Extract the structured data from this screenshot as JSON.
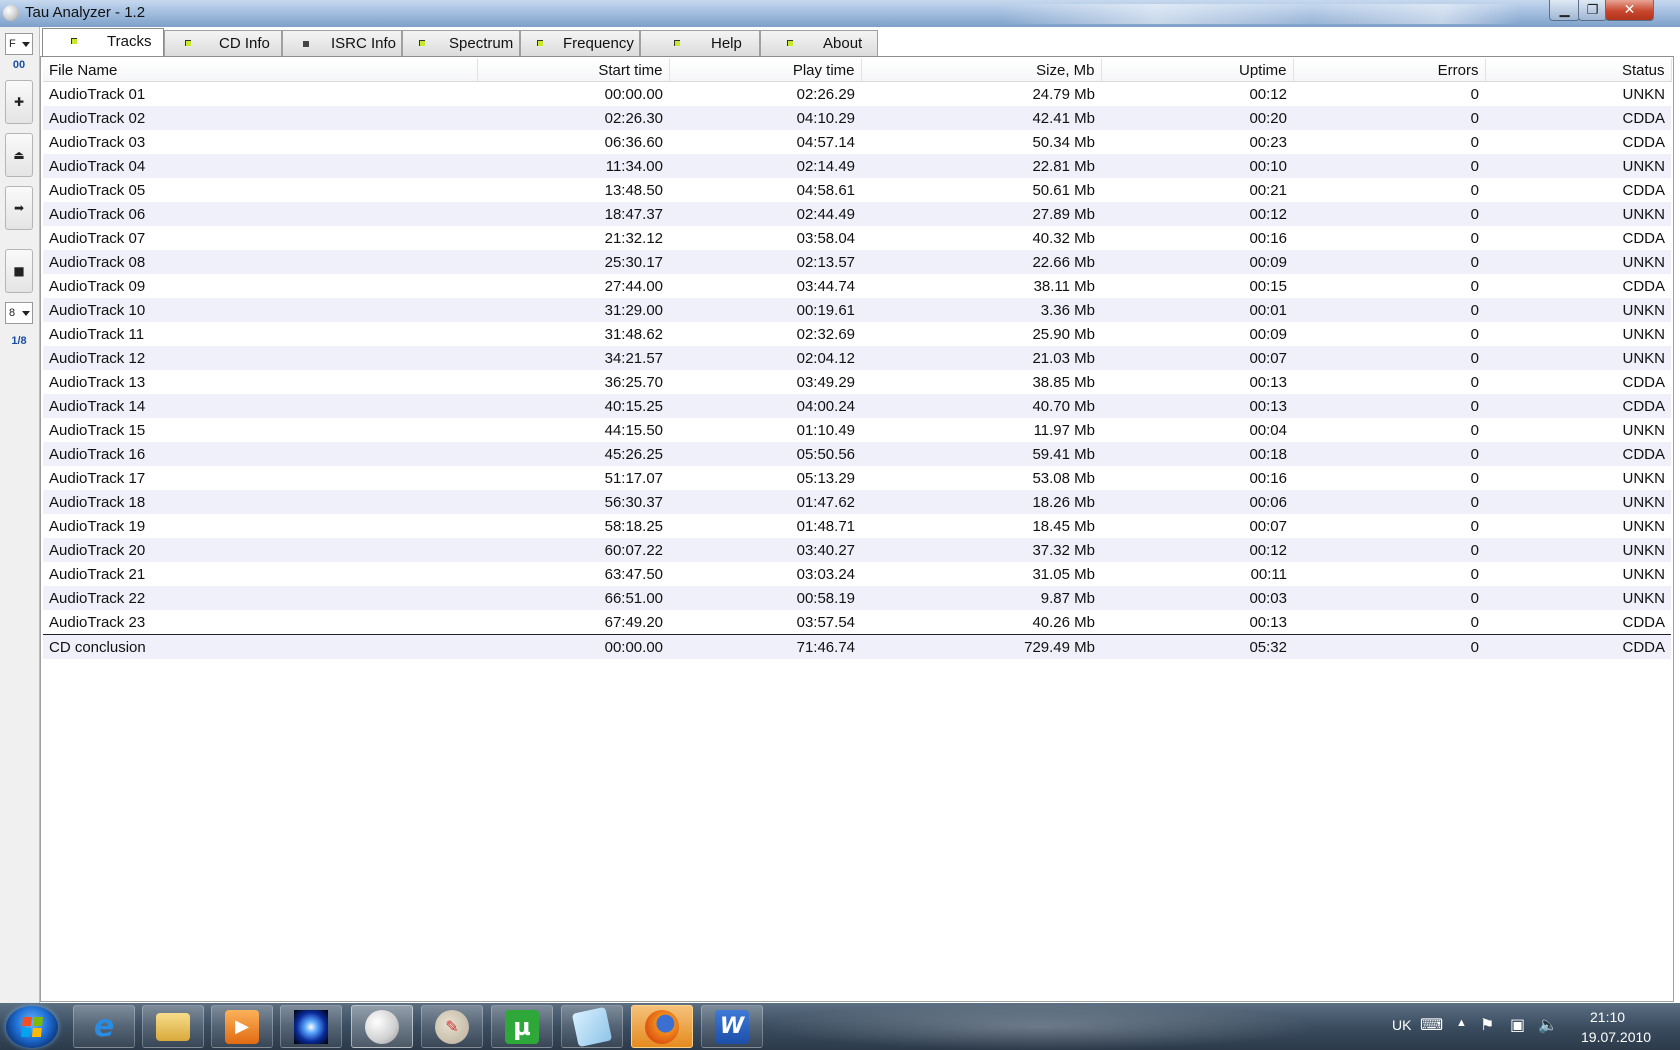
{
  "window": {
    "title": "Tau Analyzer - 1.2"
  },
  "left_toolbar": {
    "top_combo_value": "F",
    "top_label": "00",
    "bottom_combo_value": "8",
    "bottom_label": "1/8",
    "buttons": [
      "plus-icon",
      "eject-icon",
      "forward-icon",
      "stop-icon"
    ]
  },
  "tabs": [
    {
      "label": "Tracks",
      "active": true
    },
    {
      "label": "CD Info"
    },
    {
      "label": "ISRC Info"
    },
    {
      "label": "Spectrum"
    },
    {
      "label": "Frequency"
    },
    {
      "label": "Help"
    },
    {
      "label": "About"
    }
  ],
  "table": {
    "columns": [
      "File Name",
      "Start time",
      "Play time",
      "Size, Mb",
      "Uptime",
      "Errors",
      "Status"
    ],
    "rows": [
      [
        "AudioTrack 01",
        "00:00.00",
        "02:26.29",
        "24.79 Mb",
        "00:12",
        "0",
        "UNKN"
      ],
      [
        "AudioTrack 02",
        "02:26.30",
        "04:10.29",
        "42.41 Mb",
        "00:20",
        "0",
        "CDDA"
      ],
      [
        "AudioTrack 03",
        "06:36.60",
        "04:57.14",
        "50.34 Mb",
        "00:23",
        "0",
        "CDDA"
      ],
      [
        "AudioTrack 04",
        "11:34.00",
        "02:14.49",
        "22.81 Mb",
        "00:10",
        "0",
        "UNKN"
      ],
      [
        "AudioTrack 05",
        "13:48.50",
        "04:58.61",
        "50.61 Mb",
        "00:21",
        "0",
        "CDDA"
      ],
      [
        "AudioTrack 06",
        "18:47.37",
        "02:44.49",
        "27.89 Mb",
        "00:12",
        "0",
        "UNKN"
      ],
      [
        "AudioTrack 07",
        "21:32.12",
        "03:58.04",
        "40.32 Mb",
        "00:16",
        "0",
        "CDDA"
      ],
      [
        "AudioTrack 08",
        "25:30.17",
        "02:13.57",
        "22.66 Mb",
        "00:09",
        "0",
        "UNKN"
      ],
      [
        "AudioTrack 09",
        "27:44.00",
        "03:44.74",
        "38.11 Mb",
        "00:15",
        "0",
        "CDDA"
      ],
      [
        "AudioTrack 10",
        "31:29.00",
        "00:19.61",
        "3.36 Mb",
        "00:01",
        "0",
        "UNKN"
      ],
      [
        "AudioTrack 11",
        "31:48.62",
        "02:32.69",
        "25.90 Mb",
        "00:09",
        "0",
        "UNKN"
      ],
      [
        "AudioTrack 12",
        "34:21.57",
        "02:04.12",
        "21.03 Mb",
        "00:07",
        "0",
        "UNKN"
      ],
      [
        "AudioTrack 13",
        "36:25.70",
        "03:49.29",
        "38.85 Mb",
        "00:13",
        "0",
        "CDDA"
      ],
      [
        "AudioTrack 14",
        "40:15.25",
        "04:00.24",
        "40.70 Mb",
        "00:13",
        "0",
        "CDDA"
      ],
      [
        "AudioTrack 15",
        "44:15.50",
        "01:10.49",
        "11.97 Mb",
        "00:04",
        "0",
        "UNKN"
      ],
      [
        "AudioTrack 16",
        "45:26.25",
        "05:50.56",
        "59.41 Mb",
        "00:18",
        "0",
        "CDDA"
      ],
      [
        "AudioTrack 17",
        "51:17.07",
        "05:13.29",
        "53.08 Mb",
        "00:16",
        "0",
        "UNKN"
      ],
      [
        "AudioTrack 18",
        "56:30.37",
        "01:47.62",
        "18.26 Mb",
        "00:06",
        "0",
        "UNKN"
      ],
      [
        "AudioTrack 19",
        "58:18.25",
        "01:48.71",
        "18.45 Mb",
        "00:07",
        "0",
        "UNKN"
      ],
      [
        "AudioTrack 20",
        "60:07.22",
        "03:40.27",
        "37.32 Mb",
        "00:12",
        "0",
        "UNKN"
      ],
      [
        "AudioTrack 21",
        "63:47.50",
        "03:03.24",
        "31.05 Mb",
        "00:11",
        "0",
        "UNKN"
      ],
      [
        "AudioTrack 22",
        "66:51.00",
        "00:58.19",
        "9.87 Mb",
        "00:03",
        "0",
        "UNKN"
      ],
      [
        "AudioTrack 23",
        "67:49.20",
        "03:57.54",
        "40.26 Mb",
        "00:13",
        "0",
        "CDDA"
      ]
    ],
    "summary": [
      "CD conclusion",
      "00:00.00",
      "71:46.74",
      "729.49 Mb",
      "05:32",
      "0",
      "CDDA"
    ]
  },
  "taskbar": {
    "apps": [
      "internet-explorer-icon",
      "folder-icon",
      "media-player-icon",
      "starburst-icon",
      "sphere-icon",
      "paint-icon",
      "utorrent-icon",
      "notepad-icon",
      "firefox-icon",
      "word-icon"
    ],
    "active_app": "firefox-icon",
    "language": "UK",
    "time": "21:10",
    "date": "19.07.2010"
  },
  "colors": {
    "row_alt": "#f0f0fb",
    "toolbar_label": "#1a4fa0",
    "tab_led": "#c8e82a"
  }
}
